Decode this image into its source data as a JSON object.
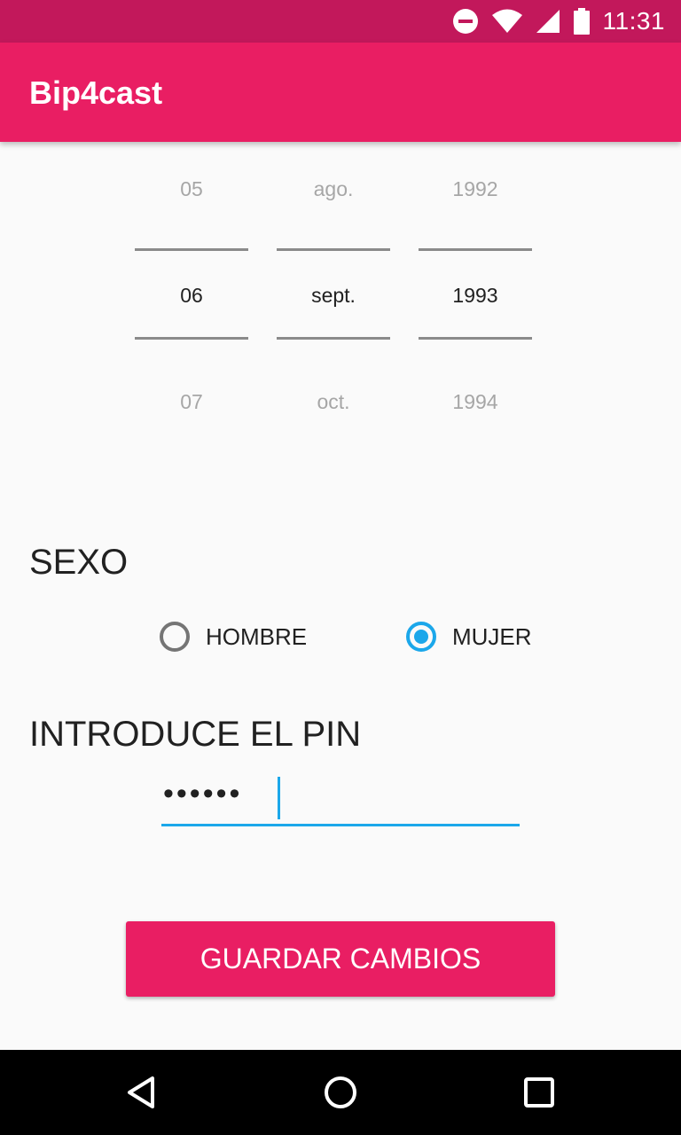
{
  "status_bar": {
    "time": "11:31",
    "icons": [
      "do-not-disturb-icon",
      "wifi-icon",
      "signal-icon",
      "battery-icon"
    ],
    "background": "#c2185b"
  },
  "app_bar": {
    "title": "Bip4cast",
    "background": "#e91e63"
  },
  "date_picker": {
    "day": {
      "prev": "05",
      "current": "06",
      "next": "07"
    },
    "month": {
      "prev": "ago.",
      "current": "sept.",
      "next": "oct."
    },
    "year": {
      "prev": "1992",
      "current": "1993",
      "next": "1994"
    }
  },
  "sex": {
    "label": "SEXO",
    "options": [
      {
        "label": "HOMBRE",
        "checked": false
      },
      {
        "label": "MUJER",
        "checked": true
      }
    ]
  },
  "pin": {
    "label": "INTRODUCE EL PIN",
    "masked_value": "••••••"
  },
  "save_button": {
    "label": "GUARDAR CAMBIOS"
  },
  "nav_bar": {
    "icons": [
      "back-icon",
      "home-icon",
      "recents-icon"
    ]
  },
  "colors": {
    "accent": "#e91e63",
    "primary_dark": "#c2185b",
    "control_active": "#1ba7ea"
  }
}
